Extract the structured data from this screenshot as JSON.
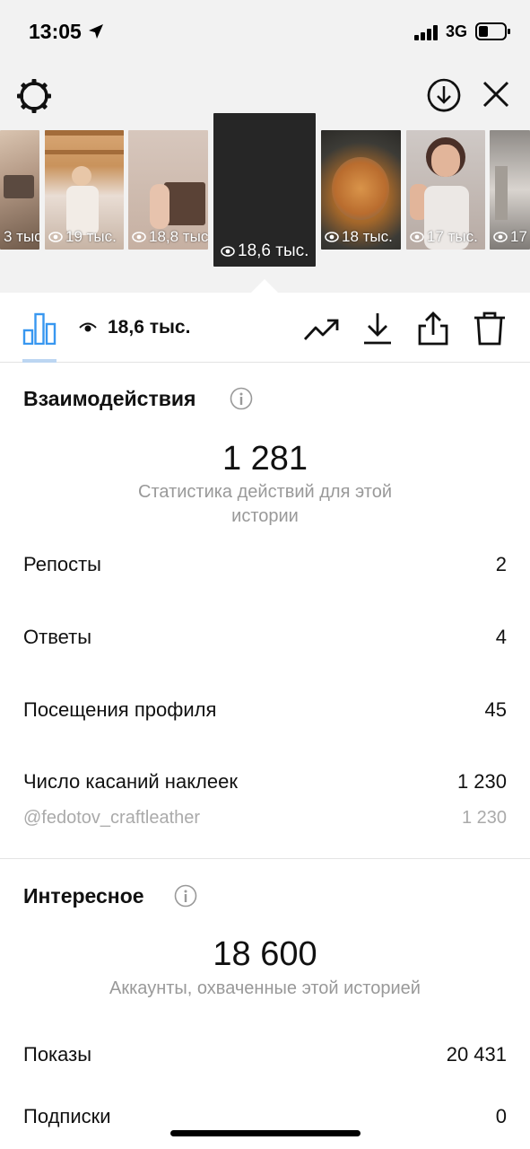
{
  "status_bar": {
    "time": "13:05",
    "network": "3G"
  },
  "stories": [
    {
      "views": "3 тыс."
    },
    {
      "views": "19 тыс."
    },
    {
      "views": "18,8 тыс."
    },
    {
      "views": "18,6 тыс.",
      "selected": true
    },
    {
      "views": "18 тыс."
    },
    {
      "views": "17 тыс."
    },
    {
      "views": "17"
    }
  ],
  "toolbar": {
    "views": "18,6 тыс.",
    "icons": [
      "bar-chart-icon",
      "eye-icon",
      "trend-icon",
      "download-icon",
      "share-icon",
      "trash-icon"
    ]
  },
  "interactions": {
    "title": "Взаимодействия",
    "total": "1 281",
    "caption": "Статистика действий для этой истории",
    "rows": [
      {
        "label": "Репосты",
        "value": "2"
      },
      {
        "label": "Ответы",
        "value": "4"
      },
      {
        "label": "Посещения профиля",
        "value": "45"
      },
      {
        "label": "Число касаний наклеек",
        "value": "1 230"
      }
    ],
    "sticker_account": {
      "label": "@fedotov_craftleather",
      "value": "1 230"
    }
  },
  "discovery": {
    "title": "Интересное",
    "total": "18 600",
    "caption": "Аккаунты, охваченные этой историей",
    "rows": [
      {
        "label": "Показы",
        "value": "20 431"
      },
      {
        "label": "Подписки",
        "value": "0"
      }
    ]
  },
  "colors": {
    "accent_blue": "#3897f0",
    "header_bg": "#f2f2f2"
  }
}
